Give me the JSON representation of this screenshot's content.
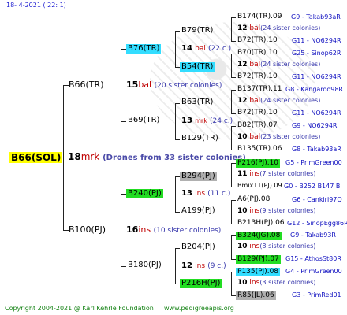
{
  "header": "18-  4-2021 ( 22:  1)",
  "footer": {
    "copyright": "Copyright 2004-2021 @ Karl Kehrle Foundation",
    "site": "www.pedigreeapis.org"
  },
  "colors": {
    "highlight_yellow": "#ffff00",
    "highlight_cyan": "#33ddff",
    "highlight_green": "#22dd22",
    "highlight_grey": "#b0b0b0",
    "red": "#c00000",
    "blue": "#1010c0"
  },
  "root": {
    "name": "B66(SOL)",
    "num": "18",
    "grp": "mrk",
    "sis": "(Drones from 33 sister colonies)"
  },
  "l1": [
    {
      "name": "B66(TR)",
      "num": "15",
      "grp": "bal",
      "sis": "(20 sister colonies)"
    },
    {
      "name": "B100(PJ)",
      "num": "16",
      "grp": "ins",
      "sis": "(10 sister colonies)"
    }
  ],
  "l2": [
    {
      "name": "B76(TR)",
      "num": "14",
      "grp": "bal",
      "sis": "(22 c.)"
    },
    {
      "name": "B69(TR)",
      "num": "13",
      "grp": "mrk",
      "sis": "(24 c.)"
    },
    {
      "name": "B240(PJ)",
      "num": "13",
      "grp": "ins",
      "sis": "(11 c.)"
    },
    {
      "name": "B180(PJ)",
      "num": "12",
      "grp": "ins",
      "sis": "(9 c.)"
    }
  ],
  "l3": [
    {
      "name": "B79(TR)"
    },
    {
      "name": "B54(TR)"
    },
    {
      "name": "B63(TR)"
    },
    {
      "name": "B129(TR)"
    },
    {
      "name": "B294(PJ)"
    },
    {
      "name": "A199(PJ)"
    },
    {
      "name": "B204(PJ)"
    },
    {
      "name": "P216H(PJ)"
    }
  ],
  "l4": [
    {
      "top": "B174(TR).09",
      "topinfo": "G9 - Takab93aR",
      "num": "12",
      "grp": "bal",
      "sis": "(24 sister colonies)",
      "bot": "B72(TR).10",
      "botinfo": "G11 - NO6294R"
    },
    {
      "top": "B70(TR).10",
      "topinfo": "G25 - Sinop62R",
      "num": "12",
      "grp": "bal",
      "sis": "(24 sister colonies)",
      "bot": "B72(TR).10",
      "botinfo": "G11 - NO6294R"
    },
    {
      "top": "B137(TR).11",
      "topinfo": "G8 - Kangaroo98R",
      "num": "12",
      "grp": "bal",
      "sis": "(24 sister colonies)",
      "bot": "B72(TR).10",
      "botinfo": "G11 - NO6294R"
    },
    {
      "top": "B82(TR).07",
      "topinfo": "G9 - NO6294R",
      "num": "10",
      "grp": "bal",
      "sis": "(23 sister colonies)",
      "bot": "B135(TR).06",
      "botinfo": "G8 - Takab93aR"
    },
    {
      "top": "P216(PJ).10",
      "topinfo": "G5 - PrimGreen00",
      "num": "11",
      "grp": "ins",
      "sis": "(7 sister colonies)",
      "bot": "Bmix11(PJ).09",
      "botinfo": "G0 - B252 B147 B"
    },
    {
      "top": "A6(PJ).08",
      "topinfo": "G6 - Cankiri97Q",
      "num": "10",
      "grp": "ins",
      "sis": "(9 sister colonies)",
      "bot": "B213H(PJ).06",
      "botinfo": "G12 - SinopEgg86R"
    },
    {
      "top": "B324(JG).08",
      "topinfo": "G9 - Takab93R",
      "num": "10",
      "grp": "ins",
      "sis": "(8 sister colonies)",
      "bot": "B129(PJ).07",
      "botinfo": "G15 - AthosSt80R"
    },
    {
      "top": "P135(PJ).08",
      "topinfo": "G4 - PrimGreen00",
      "num": "10",
      "grp": "ins",
      "sis": "(3 sister colonies)",
      "bot": "R85(JL).06",
      "botinfo": "G3 - PrimRed01"
    }
  ]
}
